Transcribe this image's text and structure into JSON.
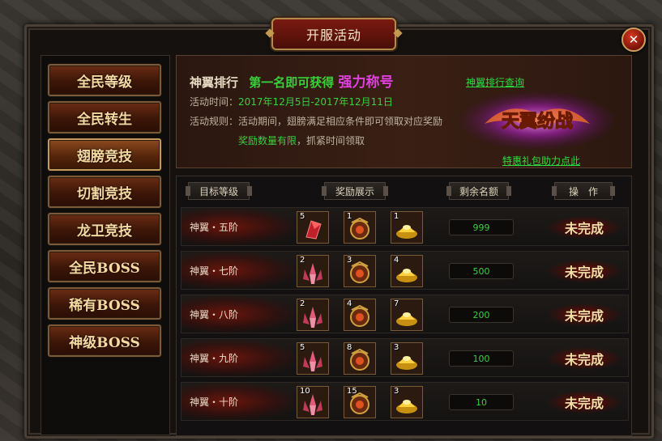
{
  "window": {
    "title": "开服活动",
    "close_icon": "close-icon"
  },
  "sidebar": {
    "items": [
      {
        "label": "全民等级",
        "active": false
      },
      {
        "label": "全民转生",
        "active": false
      },
      {
        "label": "翅膀竞技",
        "active": true
      },
      {
        "label": "切割竞技",
        "active": false
      },
      {
        "label": "龙卫竞技",
        "active": false
      },
      {
        "label": "全民BOSS",
        "active": false
      },
      {
        "label": "稀有BOSS",
        "active": false
      },
      {
        "label": "神级BOSS",
        "active": false
      }
    ]
  },
  "banner": {
    "rank_prefix": "神翼排行",
    "first_text": "第一名即可获得",
    "title_text": "强力称号",
    "rank_link": "神翼排行查询",
    "time_label": "活动时间：",
    "time_value": "2017年12月5日-2017年12月11日",
    "rule_label": "活动规则：",
    "rule_text": "活动期间，翅膀满足相应条件即可领取对应奖励",
    "rule_warn": "奖励数量有限",
    "rule_tail": "，抓紧时间领取",
    "promo_link": "特惠礼包助力点此",
    "logo_text": "天翼纷战"
  },
  "table": {
    "headers": {
      "target": "目标等级",
      "reward": "奖励展示",
      "remain": "剩余名额",
      "action": "操　作"
    },
    "rows": [
      {
        "tier": "神翼・五阶",
        "item1": "5",
        "item2": "1",
        "item3": "1",
        "remain": "999",
        "status": "未完成"
      },
      {
        "tier": "神翼・七阶",
        "item1": "2",
        "item2": "3",
        "item3": "4",
        "remain": "500",
        "status": "未完成"
      },
      {
        "tier": "神翼・八阶",
        "item1": "2",
        "item2": "4",
        "item3": "7",
        "remain": "200",
        "status": "未完成"
      },
      {
        "tier": "神翼・九阶",
        "item1": "5",
        "item2": "8",
        "item3": "3",
        "remain": "100",
        "status": "未完成"
      },
      {
        "tier": "神翼・十阶",
        "item1": "10",
        "item2": "15",
        "item3": "3",
        "remain": "10",
        "status": "未完成"
      }
    ]
  },
  "colors": {
    "accent_green": "#39d03a",
    "title_magenta": "#e040e0",
    "panel_bg": "#14110f",
    "button_gold": "#f6d9a2"
  }
}
